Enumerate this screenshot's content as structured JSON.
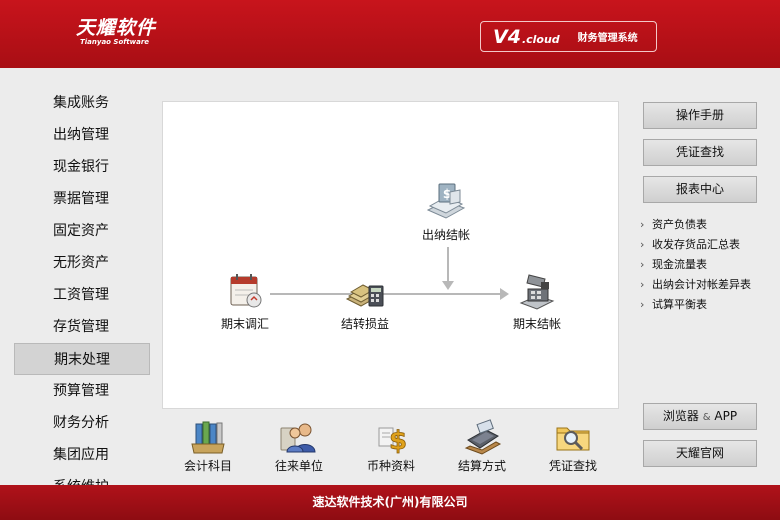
{
  "header": {
    "logo_main": "天耀软件",
    "logo_sub": "Tianyao Software",
    "version": "V4",
    "version_suffix": ".cloud",
    "product_name": "财务管理系统"
  },
  "nav": {
    "items": [
      {
        "label": "集成账务"
      },
      {
        "label": "出纳管理"
      },
      {
        "label": "现金银行"
      },
      {
        "label": "票据管理"
      },
      {
        "label": "固定资产"
      },
      {
        "label": "无形资产"
      },
      {
        "label": "工资管理"
      },
      {
        "label": "存货管理"
      },
      {
        "label": "期末处理",
        "active": true
      },
      {
        "label": "预算管理"
      },
      {
        "label": "财务分析"
      },
      {
        "label": "集团应用"
      },
      {
        "label": "系统维护"
      }
    ]
  },
  "flow": {
    "nodes": {
      "cashier_close": "出纳结帐",
      "period_adjust": "期末调汇",
      "transfer_pl": "结转损益",
      "period_close": "期末结帐"
    }
  },
  "shortcuts": [
    {
      "label": "会计科目",
      "icon": "ledger-binders-icon"
    },
    {
      "label": "往来单位",
      "icon": "contacts-people-icon"
    },
    {
      "label": "币种资料",
      "icon": "currency-dollar-icon"
    },
    {
      "label": "结算方式",
      "icon": "payment-terminal-icon"
    },
    {
      "label": "凭证查找",
      "icon": "folder-search-icon"
    }
  ],
  "right": {
    "manual": "操作手册",
    "voucher_search": "凭证查找",
    "report_center": "报表中心",
    "reports": [
      "资产负债表",
      "收发存货品汇总表",
      "现金流量表",
      "出纳会计对帐差异表",
      "试算平衡表"
    ],
    "browser_label": "浏览器",
    "browser_amp": "&",
    "browser_app": "APP",
    "official_site": "天耀官网"
  },
  "footer": {
    "company": "速达软件技术(广州)有限公司"
  },
  "colors": {
    "brand_red": "#c8141c",
    "footer_red": "#a00f16",
    "flow_line": "#b8b8b8"
  }
}
